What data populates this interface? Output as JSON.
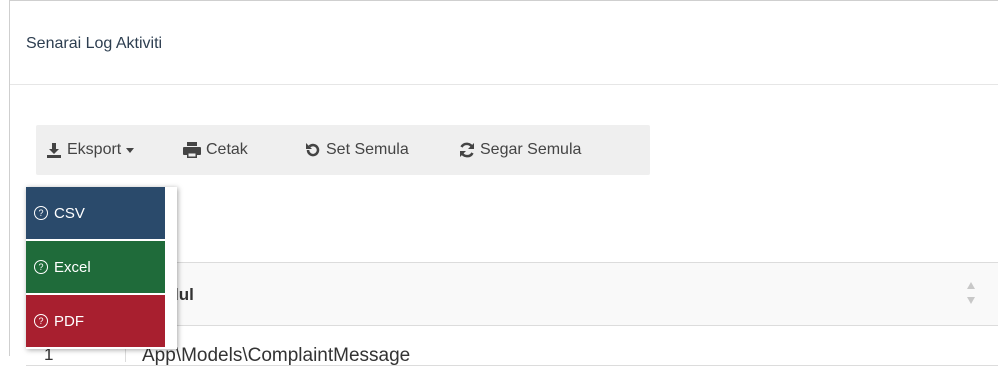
{
  "panel": {
    "title": "Senarai Log Aktiviti"
  },
  "toolbar": {
    "export_label": "Eksport",
    "print_label": "Cetak",
    "reset_label": "Set Semula",
    "refresh_label": "Segar Semula"
  },
  "export_menu": {
    "items": [
      {
        "label": "CSV",
        "color": "#2a4a6b"
      },
      {
        "label": "Excel",
        "color": "#1f6b3a"
      },
      {
        "label": "PDF",
        "color": "#a81f2f"
      }
    ]
  },
  "table": {
    "header_label": "odul",
    "first_row_number": "1",
    "first_row_text": "App\\Models\\ComplaintMessage"
  }
}
